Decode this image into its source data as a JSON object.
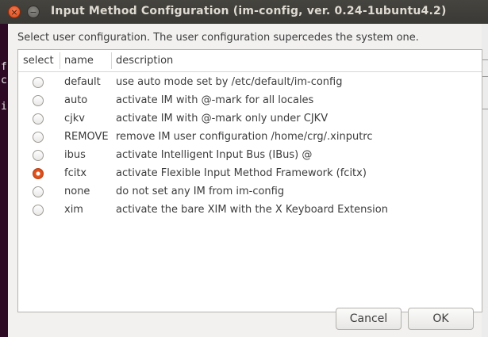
{
  "window": {
    "title": "Input Method Configuration (im-config, ver. 0.24-1ubuntu4.2)",
    "close_glyph": "×",
    "minimize_glyph": "−"
  },
  "dialog": {
    "instruction": "Select user configuration. The user configuration supercedes the system one.",
    "columns": [
      "select",
      "name",
      "description"
    ],
    "rows": [
      {
        "name": "default",
        "description": "use auto mode set by /etc/default/im-config",
        "selected": false
      },
      {
        "name": "auto",
        "description": "activate IM with @-mark for all locales",
        "selected": false
      },
      {
        "name": "cjkv",
        "description": "activate IM with @-mark only under CJKV",
        "selected": false
      },
      {
        "name": "REMOVE",
        "description": "remove IM user configuration /home/crg/.xinputrc",
        "selected": false
      },
      {
        "name": "ibus",
        "description": "activate Intelligent Input Bus (IBus) @",
        "selected": false
      },
      {
        "name": "fcitx",
        "description": "activate Flexible Input Method Framework (fcitx)",
        "selected": true
      },
      {
        "name": "none",
        "description": "do not set any IM from im-config",
        "selected": false
      },
      {
        "name": "xim",
        "description": "activate the bare XIM with the X Keyboard Extension",
        "selected": false
      }
    ],
    "buttons": {
      "cancel": "Cancel",
      "ok": "OK"
    }
  },
  "background_terminal": {
    "lines": [
      "f",
      "c",
      "",
      "i"
    ]
  },
  "colors": {
    "accent": "#dd4814",
    "titlebar": "#3c3b37",
    "dialog_bg": "#f2f1f0"
  }
}
